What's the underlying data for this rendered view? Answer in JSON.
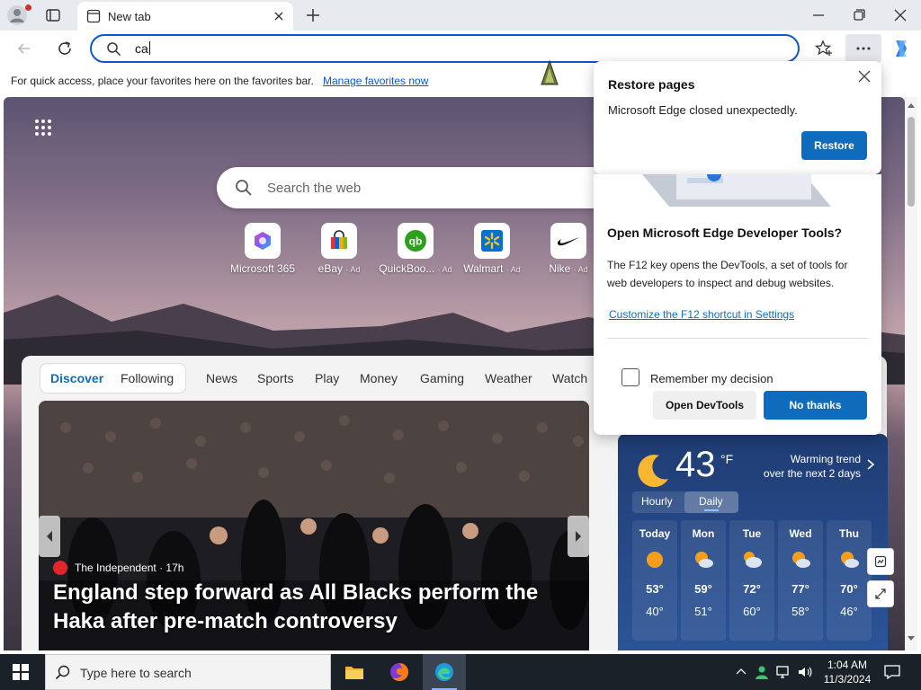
{
  "browser": {
    "tab_title": "New tab",
    "address_value": "ca"
  },
  "favorites_bar": {
    "message": "For quick access, place your favorites here on the favorites bar.",
    "link": "Manage favorites now"
  },
  "newtab": {
    "search_placeholder": "Search the web",
    "quick_links": [
      {
        "label": "Microsoft 365",
        "ad": ""
      },
      {
        "label": "eBay",
        "ad": "· Ad"
      },
      {
        "label": "QuickBoo...",
        "ad": "· Ad"
      },
      {
        "label": "Walmart",
        "ad": "· Ad"
      },
      {
        "label": "Nike",
        "ad": "· Ad"
      }
    ],
    "feed_tabs": [
      "Discover",
      "Following",
      "News",
      "Sports",
      "Play",
      "Money",
      "Gaming",
      "Weather",
      "Watch"
    ],
    "hero": {
      "source": "The Independent · 17h",
      "title": "England step forward as All Blacks perform the Haka after pre-match controversy"
    }
  },
  "weather": {
    "temp": "43",
    "unit": "°F",
    "trend_line1": "Warming trend",
    "trend_line2": "over the next 2 days",
    "tabs": [
      "Hourly",
      "Daily"
    ],
    "days": [
      {
        "name": "Today",
        "hi": "53°",
        "lo": "40°",
        "icon": "sun-icon"
      },
      {
        "name": "Mon",
        "hi": "59°",
        "lo": "51°",
        "icon": "partly-cloudy-icon"
      },
      {
        "name": "Tue",
        "hi": "72°",
        "lo": "60°",
        "icon": "partly-cloudy-icon"
      },
      {
        "name": "Wed",
        "hi": "77°",
        "lo": "58°",
        "icon": "partly-cloudy-icon"
      },
      {
        "name": "Thu",
        "hi": "70°",
        "lo": "46°",
        "icon": "partly-cloudy-icon"
      }
    ]
  },
  "restore_popup": {
    "title": "Restore pages",
    "message": "Microsoft Edge closed unexpectedly.",
    "button": "Restore"
  },
  "devtools_popup": {
    "title": "Open Microsoft Edge Developer Tools?",
    "body": "The F12 key opens the DevTools, a set of tools for web developers to inspect and debug websites.",
    "link": "Customize the F12 shortcut in Settings",
    "checkbox_label": "Remember my decision",
    "open_button": "Open DevTools",
    "decline_button": "No thanks"
  },
  "taskbar": {
    "search_placeholder": "Type here to search",
    "time": "1:04 AM",
    "date": "11/3/2024"
  },
  "colors": {
    "accent": "#0f6cbd",
    "omnibox_border": "#0b57d0",
    "taskbar": "#1b2129"
  }
}
